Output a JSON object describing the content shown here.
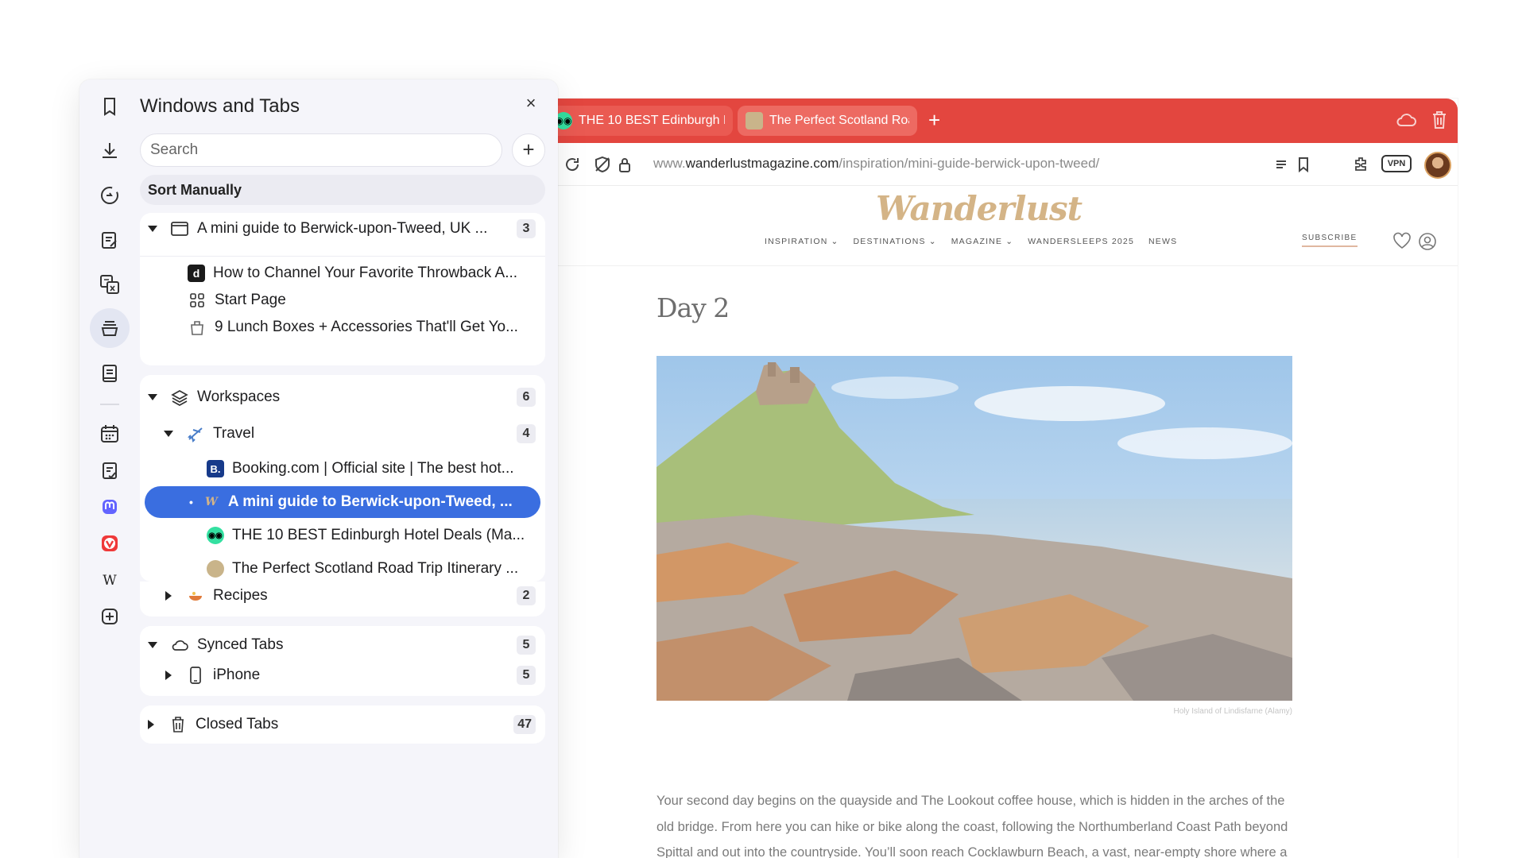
{
  "browser": {
    "tabs": [
      {
        "label": "THE 10 BEST Edinburgh H",
        "favicon": "tripadvisor-icon"
      },
      {
        "label": "The Perfect Scotland Roac",
        "favicon": "scotland-landscape-icon"
      }
    ],
    "new_tab_label": "+",
    "accent_color": "#e3463f",
    "url_prefix": "www.",
    "url_domain": "wanderlustmagazine.com",
    "url_path": "/inspiration/mini-guide-berwick-upon-tweed/",
    "vpn_label": "VPN"
  },
  "page": {
    "logo": "Wanderlust",
    "nav": [
      "INSPIRATION",
      "DESTINATIONS",
      "MAGAZINE",
      "WANDERSLEEPS 2025",
      "NEWS"
    ],
    "subscribe": "SUBSCRIBE",
    "heading": "Day 2",
    "caption": "Holy Island of Lindisfarne (Alamy)",
    "paragraph": "Your second day begins on the quayside and The Lookout coffee house, which is hidden in the arches of the old bridge. From here you can hike or bike along the coast, following the Northumberland Coast Path beyond Spittal and out into the countryside. You’ll soon reach Cocklawburn Beach, a vast, near-empty shore where a"
  },
  "panel": {
    "title": "Windows and Tabs",
    "close_label": "×",
    "search_placeholder": "Search",
    "add_label": "+",
    "sort_label": "Sort Manually",
    "window_group": {
      "label": "A mini guide to Berwick-upon-Tweed, UK ...",
      "count": "3",
      "items": [
        {
          "label": "How to Channel Your Favorite Throwback A...",
          "favicon": "d"
        },
        {
          "label": "Start Page"
        },
        {
          "label": "9 Lunch Boxes + Accessories That'll Get Yo..."
        }
      ]
    },
    "workspaces": {
      "label": "Workspaces",
      "count": "6",
      "travel": {
        "label": "Travel",
        "count": "4",
        "items": [
          {
            "label": "Booking.com | Official site | The best hot...",
            "favicon": "B."
          },
          {
            "label": "A mini guide to Berwick-upon-Tweed, ...",
            "selected": true
          },
          {
            "label": "THE 10 BEST Edinburgh Hotel Deals (Ma..."
          },
          {
            "label": "The Perfect Scotland Road Trip Itinerary ..."
          }
        ]
      },
      "recipes": {
        "label": "Recipes",
        "count": "2"
      }
    },
    "synced": {
      "label": "Synced Tabs",
      "count": "5",
      "iphone": {
        "label": "iPhone",
        "count": "5"
      }
    },
    "closed": {
      "label": "Closed Tabs",
      "count": "47"
    },
    "selected_color": "#3a6ee0"
  }
}
